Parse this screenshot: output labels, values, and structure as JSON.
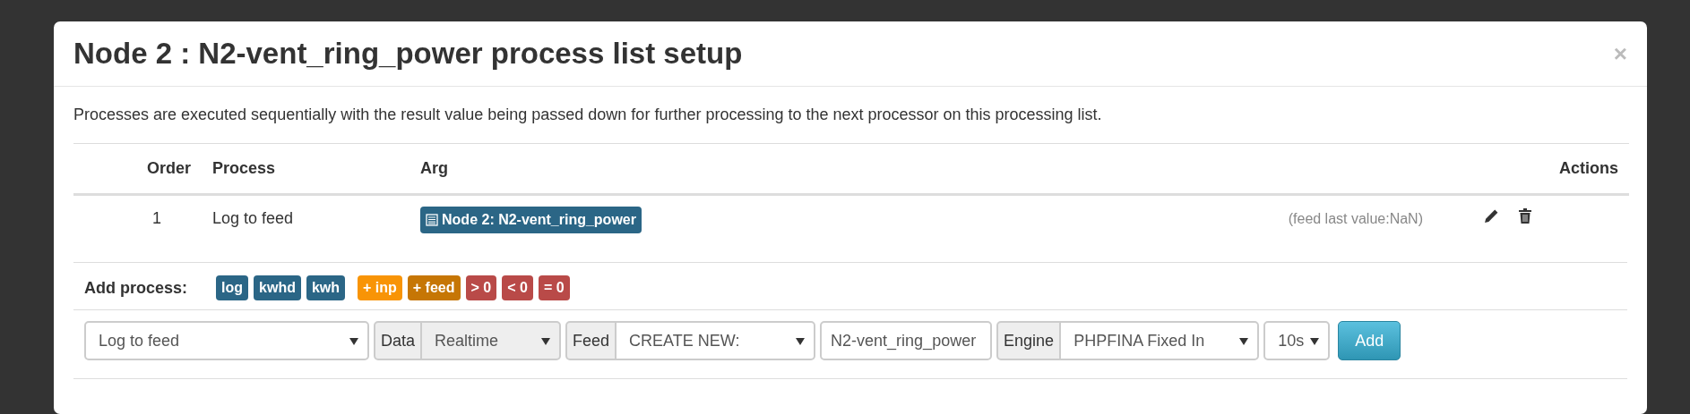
{
  "modal": {
    "title": "Node 2 : N2-vent_ring_power process list setup",
    "close": "×",
    "description": "Processes are executed sequentially with the result value being passed down for further processing to the next processor on this processing list.",
    "table": {
      "columns": [
        "Order",
        "Process",
        "Arg",
        "Actions"
      ],
      "rows": [
        {
          "order": "1",
          "process": "Log to feed",
          "arg": "Node 2: N2-vent_ring_power",
          "info": "(feed last value:NaN)"
        }
      ]
    },
    "add_process": {
      "label": "Add process:",
      "badges": [
        {
          "text": "log",
          "color": "#2b6686"
        },
        {
          "text": "kwhd",
          "color": "#2b6686"
        },
        {
          "text": "kwh",
          "color": "#2b6686"
        },
        {
          "text": "+ inp",
          "color": "#f89406"
        },
        {
          "text": "+ feed",
          "color": "#c67605"
        },
        {
          "text": "> 0",
          "color": "#b94a48"
        },
        {
          "text": "< 0",
          "color": "#b94a48"
        },
        {
          "text": "= 0",
          "color": "#b94a48"
        }
      ]
    },
    "form": [
      {
        "kind": "select",
        "value": "Log to feed",
        "disabled": false
      },
      {
        "kind": "addon",
        "text": "Data"
      },
      {
        "kind": "select",
        "value": "Realtime",
        "disabled": true
      },
      {
        "kind": "addon",
        "text": "Feed"
      },
      {
        "kind": "select",
        "value": "CREATE NEW:",
        "disabled": false
      },
      {
        "kind": "input",
        "value": "N2-vent_ring_power"
      },
      {
        "kind": "addon",
        "text": "Engine"
      },
      {
        "kind": "select",
        "value": "PHPFINA Fixed In",
        "disabled": false
      },
      {
        "kind": "select",
        "value": "10s",
        "disabled": false
      },
      {
        "kind": "button",
        "text": "Add"
      }
    ]
  }
}
